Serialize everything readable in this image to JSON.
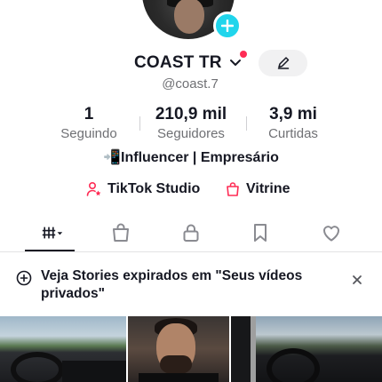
{
  "profile": {
    "display_name": "COAST TR",
    "username": "@coast.7"
  },
  "stats": [
    {
      "value": "1",
      "label": "Seguindo"
    },
    {
      "value": "210,9 mil",
      "label": "Seguidores"
    },
    {
      "value": "3,9 mi",
      "label": "Curtidas"
    }
  ],
  "bio": "📲Influencer | Empresário",
  "links": {
    "studio": "TikTok Studio",
    "vitrine": "Vitrine"
  },
  "tabs": [
    {
      "icon": "grid-icon"
    },
    {
      "icon": "shopping-bag-icon"
    },
    {
      "icon": "lock-icon"
    },
    {
      "icon": "bookmark-icon"
    },
    {
      "icon": "heart-icon"
    }
  ],
  "banner": {
    "text": "Veja Stories expirados em \"Seus vídeos privados\""
  },
  "colors": {
    "accent": "#fe2c55",
    "badge": "#20d5ec",
    "text": "#161823",
    "muted": "#6f7074"
  }
}
